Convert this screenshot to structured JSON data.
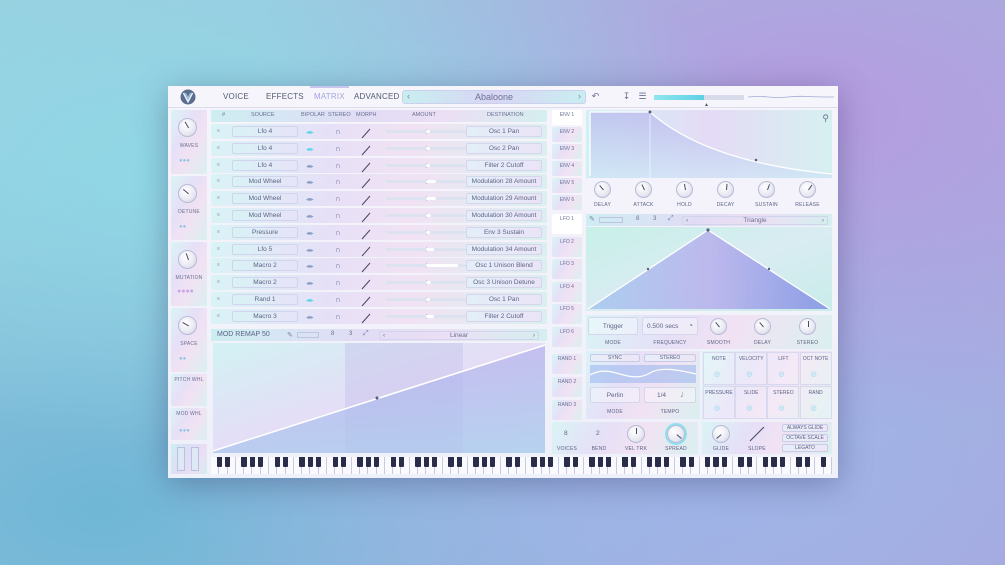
{
  "header": {
    "tabs": [
      {
        "label": "VOICE"
      },
      {
        "label": "EFFECTS"
      },
      {
        "label": "MATRIX"
      },
      {
        "label": "ADVANCED"
      }
    ],
    "active_tab": "MATRIX",
    "preset_name": "Abaloone",
    "volume_fraction": 0.55
  },
  "left_macros": [
    {
      "label": "WAVES"
    },
    {
      "label": "DETUNE"
    },
    {
      "label": "MUTATION"
    },
    {
      "label": "SPACE"
    },
    {
      "label": "PITCH WHL"
    },
    {
      "label": "MOD WHL"
    }
  ],
  "matrix": {
    "headers": {
      "num": "#",
      "source": "SOURCE",
      "bipolar": "BIPOLAR",
      "stereo": "STEREO",
      "morph": "MORPH",
      "amount": "AMOUNT",
      "destination": "DESTINATION"
    },
    "rows": [
      {
        "source": "Lfo 4",
        "bipolar": true,
        "amount": 0.55,
        "destination": "Osc 1 Pan"
      },
      {
        "source": "Lfo 4",
        "bipolar": true,
        "amount": 0.55,
        "destination": "Osc 2 Pan"
      },
      {
        "source": "Lfo 4",
        "bipolar": false,
        "amount": 0.55,
        "destination": "Filter 2 Cutoff"
      },
      {
        "source": "Mod Wheel",
        "bipolar": false,
        "amount": 0.62,
        "destination": "Modulation 28 Amount"
      },
      {
        "source": "Mod Wheel",
        "bipolar": false,
        "amount": 0.62,
        "destination": "Modulation 29 Amount"
      },
      {
        "source": "Mod Wheel",
        "bipolar": false,
        "amount": 0.56,
        "destination": "Modulation 30 Amount"
      },
      {
        "source": "Pressure",
        "bipolar": false,
        "amount": 0.55,
        "destination": "Env 3 Sustain"
      },
      {
        "source": "Lfo 5",
        "bipolar": false,
        "amount": 0.6,
        "destination": "Modulation 34 Amount"
      },
      {
        "source": "Macro 2",
        "bipolar": false,
        "amount": 0.9,
        "destination": "Osc 1 Unison Blend"
      },
      {
        "source": "Macro 2",
        "bipolar": false,
        "amount": 0.56,
        "destination": "Osc 3 Unison Detune"
      },
      {
        "source": "Rand 1",
        "bipolar": true,
        "amount": 0.55,
        "destination": "Osc 1 Pan"
      },
      {
        "source": "Macro 3",
        "bipolar": false,
        "amount": 0.6,
        "destination": "Filter 2 Cutoff"
      }
    ]
  },
  "remap": {
    "title": "MOD REMAP 50",
    "grid_a": "8",
    "grid_b": "3",
    "shape": "Linear"
  },
  "mod_tabs": [
    {
      "label": "ENV 1"
    },
    {
      "label": "ENV 2"
    },
    {
      "label": "ENV 3"
    },
    {
      "label": "ENV 4"
    },
    {
      "label": "ENV 5"
    },
    {
      "label": "ENV 6"
    },
    {
      "label": "LFO 1"
    },
    {
      "label": "LFO 2"
    },
    {
      "label": "LFO 3"
    },
    {
      "label": "LFO 4"
    },
    {
      "label": "LFO 5"
    },
    {
      "label": "LFO 6"
    },
    {
      "label": "RAND 1"
    },
    {
      "label": "RAND 2"
    },
    {
      "label": "RAND 3"
    }
  ],
  "envelope": {
    "knobs": [
      {
        "label": "DELAY"
      },
      {
        "label": "ATTACK"
      },
      {
        "label": "HOLD"
      },
      {
        "label": "DECAY"
      },
      {
        "label": "SUSTAIN"
      },
      {
        "label": "RELEASE"
      }
    ]
  },
  "lfo": {
    "grid_a": "8",
    "grid_b": "3",
    "shape": "Triangle",
    "mode_value": "Trigger",
    "mode_label": "MODE",
    "frequency_value": "0.500 secs",
    "frequency_label": "FREQUENCY",
    "smooth_label": "SMOOTH",
    "delay_label": "DELAY",
    "stereo_label": "STEREO"
  },
  "random": {
    "sync_label": "SYNC",
    "stereo_label": "STEREO",
    "style_value": "Perlin",
    "mode_label": "MODE",
    "tempo_value": "1/4",
    "tempo_label": "TEMPO"
  },
  "mod_grid": [
    {
      "label": "NOTE"
    },
    {
      "label": "VELOCITY"
    },
    {
      "label": "LIFT"
    },
    {
      "label": "OCT NOTE"
    },
    {
      "label": "PRESSURE"
    },
    {
      "label": "SLIDE"
    },
    {
      "label": "STEREO"
    },
    {
      "label": "RAND"
    }
  ],
  "voice": {
    "voices_value": "8",
    "voices_label": "VOICES",
    "bend_value": "2",
    "bend_label": "BEND",
    "veltrk_label": "VEL TRK",
    "spread_label": "SPREAD"
  },
  "glide": {
    "glide_label": "GLIDE",
    "slope_label": "SLOPE",
    "always_glide": "ALWAYS GLIDE",
    "octave_scale": "OCTAVE SCALE",
    "legato": "LEGATO"
  }
}
